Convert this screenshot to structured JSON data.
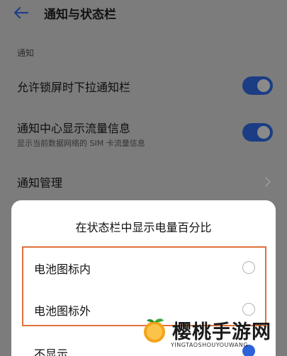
{
  "header": {
    "title": "通知与状态栏",
    "back_icon": "back-arrow-icon"
  },
  "section": {
    "label": "通知"
  },
  "settings": {
    "lock_screen_pulldown": {
      "title": "允许锁屏时下拉通知栏",
      "enabled": true
    },
    "traffic_info": {
      "title": "通知中心显示流量信息",
      "subtitle": "显示当前数据网络的 SIM 卡流量信息",
      "enabled": true
    },
    "notification_management": {
      "title": "通知管理"
    }
  },
  "dialog": {
    "title": "在状态栏中显示电量百分比",
    "options": [
      {
        "label": "电池图标内",
        "selected": false
      },
      {
        "label": "电池图标外",
        "selected": false
      },
      {
        "label": "不显示",
        "selected": true
      }
    ]
  },
  "colors": {
    "toggle_on": "#1a3d84",
    "radio_selected": "#2b62d9",
    "highlight": "#e0703a",
    "back_arrow": "#1e3f8a"
  },
  "watermark": {
    "text": "樱桃手游网",
    "subtext": "YINGTAOSHOUYOUWANG"
  }
}
